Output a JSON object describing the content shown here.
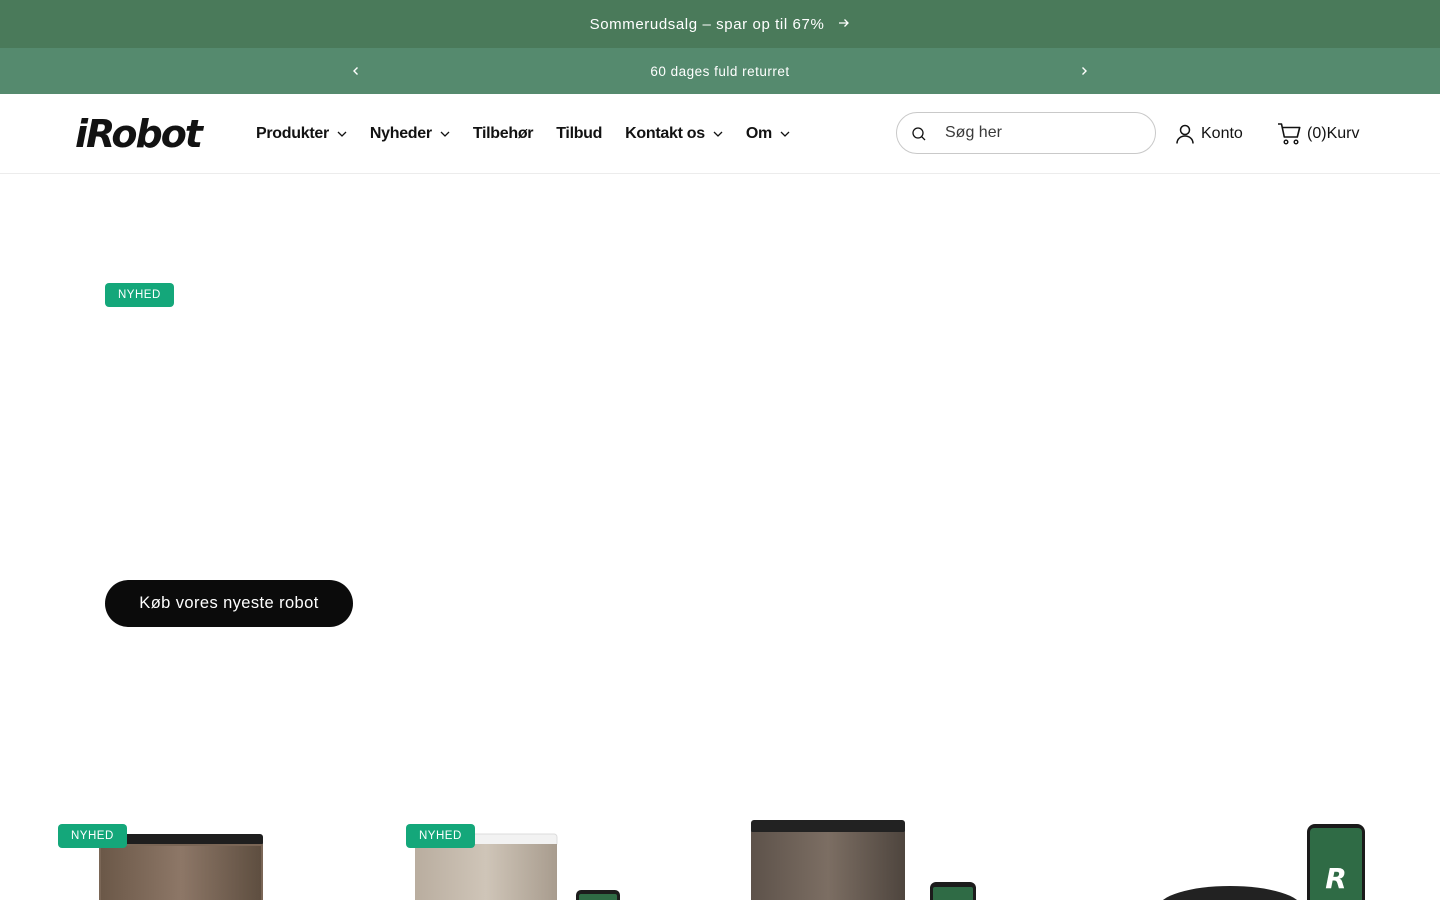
{
  "announcement": {
    "primary_text": "Sommerudsalg – spar op til 67%",
    "secondary_text": "60 dages fuld returret"
  },
  "header": {
    "logo_text": "iRobot",
    "nav": [
      {
        "label": "Produkter",
        "has_dropdown": true
      },
      {
        "label": "Nyheder",
        "has_dropdown": true
      },
      {
        "label": "Tilbehør",
        "has_dropdown": false
      },
      {
        "label": "Tilbud",
        "has_dropdown": false
      },
      {
        "label": "Kontakt os",
        "has_dropdown": true
      },
      {
        "label": "Om",
        "has_dropdown": true
      }
    ],
    "search": {
      "placeholder": "Søg her",
      "value": ""
    },
    "account_label": "Konto",
    "cart": {
      "count": "(0)",
      "label": "Kurv"
    }
  },
  "hero": {
    "badge": "NYHED",
    "cta_label": "Køb vores nyeste robot"
  },
  "products": [
    {
      "badge": "NYHED"
    },
    {
      "badge": "NYHED"
    },
    {
      "badge": ""
    },
    {
      "badge": ""
    }
  ],
  "colors": {
    "announcement_top": "#4a7a5a",
    "announcement_bottom": "#558a6e",
    "badge_green": "#14a77a",
    "cta_black": "#0b0b0b"
  }
}
